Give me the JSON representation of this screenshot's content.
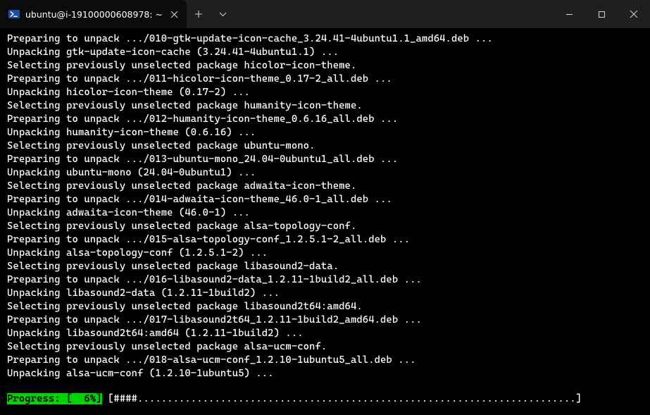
{
  "tab": {
    "title": "ubuntu@i-19100000608978: ~"
  },
  "lines": [
    "Preparing to unpack .../010-gtk-update-icon-cache_3.24.41-4ubuntu1.1_amd64.deb ...",
    "Unpacking gtk-update-icon-cache (3.24.41-4ubuntu1.1) ...",
    "Selecting previously unselected package hicolor-icon-theme.",
    "Preparing to unpack .../011-hicolor-icon-theme_0.17-2_all.deb ...",
    "Unpacking hicolor-icon-theme (0.17-2) ...",
    "Selecting previously unselected package humanity-icon-theme.",
    "Preparing to unpack .../012-humanity-icon-theme_0.6.16_all.deb ...",
    "Unpacking humanity-icon-theme (0.6.16) ...",
    "Selecting previously unselected package ubuntu-mono.",
    "Preparing to unpack .../013-ubuntu-mono_24.04-0ubuntu1_all.deb ...",
    "Unpacking ubuntu-mono (24.04-0ubuntu1) ...",
    "Selecting previously unselected package adwaita-icon-theme.",
    "Preparing to unpack .../014-adwaita-icon-theme_46.0-1_all.deb ...",
    "Unpacking adwaita-icon-theme (46.0-1) ...",
    "Selecting previously unselected package alsa-topology-conf.",
    "Preparing to unpack .../015-alsa-topology-conf_1.2.5.1-2_all.deb ...",
    "Unpacking alsa-topology-conf (1.2.5.1-2) ...",
    "Selecting previously unselected package libasound2-data.",
    "Preparing to unpack .../016-libasound2-data_1.2.11-1build2_all.deb ...",
    "Unpacking libasound2-data (1.2.11-1build2) ...",
    "Selecting previously unselected package libasound2t64:amd64.",
    "Preparing to unpack .../017-libasound2t64_1.2.11-1build2_amd64.deb ...",
    "Unpacking libasound2t64:amd64 (1.2.11-1build2) ...",
    "Selecting previously unselected package alsa-ucm-conf.",
    "Preparing to unpack .../018-alsa-ucm-conf_1.2.10-1ubuntu5_all.deb ...",
    "Unpacking alsa-ucm-conf (1.2.10-1ubuntu5) ..."
  ],
  "progress": {
    "label": "Progress: [  6%]",
    "bar": " [####..........................................................................] "
  }
}
